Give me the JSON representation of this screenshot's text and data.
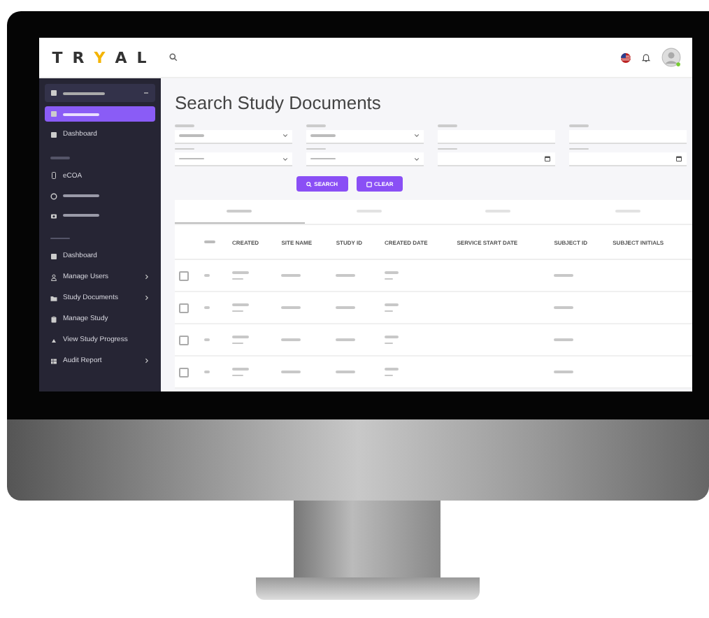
{
  "topbar": {
    "logo": {
      "left": "TR",
      "mark": "Y",
      "right": "AL"
    }
  },
  "sidebar": {
    "items": [
      {
        "kind": "account"
      },
      {
        "kind": "blurred",
        "selected": true
      },
      {
        "kind": "item",
        "label": "Dashboard",
        "selected": false,
        "submenu": false
      },
      {
        "kind": "section"
      },
      {
        "kind": "item",
        "label": "eCOA",
        "selected": false,
        "submenu": false
      },
      {
        "kind": "blurred",
        "selected": false
      },
      {
        "kind": "blurred",
        "selected": false
      },
      {
        "kind": "section"
      },
      {
        "kind": "item",
        "label": "Dashboard",
        "selected": false,
        "submenu": false
      },
      {
        "kind": "item",
        "label": "Manage Users",
        "selected": false,
        "submenu": true
      },
      {
        "kind": "item",
        "label": "Study Documents",
        "selected": false,
        "submenu": true
      },
      {
        "kind": "item",
        "label": "Manage Study",
        "selected": false,
        "submenu": false
      },
      {
        "kind": "item",
        "label": "View Study Progress",
        "selected": false,
        "submenu": false
      },
      {
        "kind": "item",
        "label": "Audit Report",
        "selected": false,
        "submenu": true
      }
    ]
  },
  "main": {
    "title": "Search Study Documents",
    "fields": [
      {
        "kind": "select"
      },
      {
        "kind": "select"
      },
      {
        "kind": "text"
      },
      {
        "kind": "text"
      },
      {
        "kind": "select"
      },
      {
        "kind": "select"
      },
      {
        "kind": "date"
      },
      {
        "kind": "date"
      }
    ],
    "buttons": [
      {
        "kind": "search",
        "label": "SEARCH"
      },
      {
        "kind": "clear",
        "label": "CLEAR"
      }
    ],
    "tabs": [
      {
        "selected": true
      },
      {
        "selected": false
      },
      {
        "selected": false
      },
      {
        "selected": false
      }
    ],
    "table": {
      "columns": [
        "",
        "",
        "CREATED",
        "SITE NAME",
        "STUDY ID",
        "CREATED DATE",
        "SERVICE START DATE",
        "SUBJECT ID",
        "SUBJECT INITIALS"
      ],
      "rows": [
        {
          "checked": false
        },
        {
          "checked": false
        },
        {
          "checked": false
        },
        {
          "checked": false
        }
      ]
    }
  }
}
